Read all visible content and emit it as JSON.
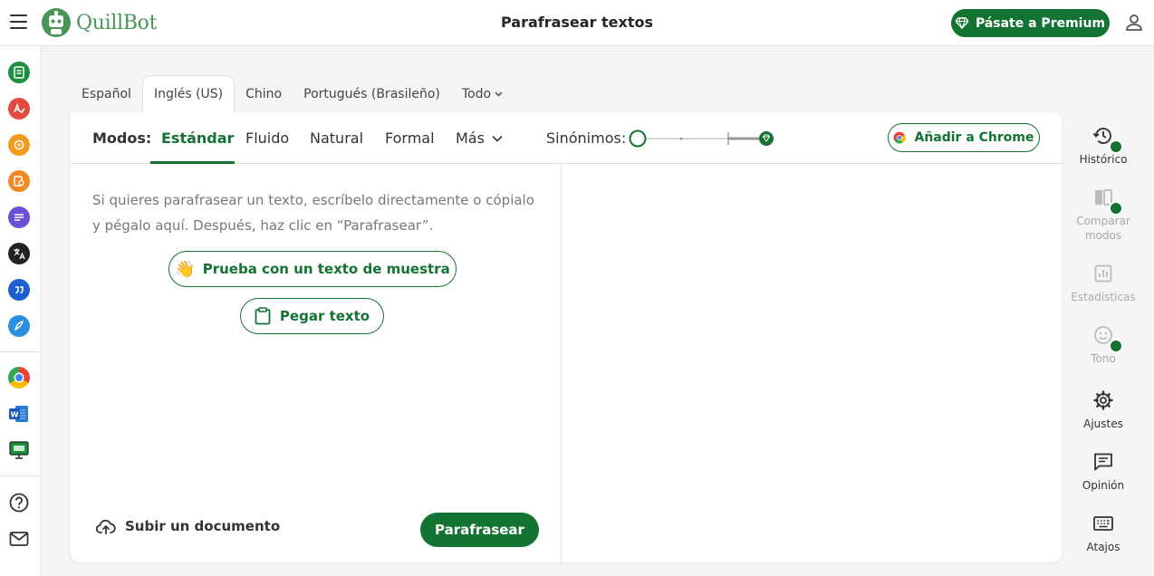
{
  "header": {
    "brand": "QuillBot",
    "title": "Parafrasear textos",
    "premium_label": "Pásate a Premium"
  },
  "left_sidebar": {
    "items": [
      {
        "name": "paraphraser-icon",
        "color": "#1a8f3c"
      },
      {
        "name": "grammar-checker-icon",
        "color": "#e04a3f"
      },
      {
        "name": "ai-detector-icon",
        "color": "#f59b1b"
      },
      {
        "name": "plagiarism-checker-icon",
        "color": "#f08a24"
      },
      {
        "name": "summarizer-icon",
        "color": "#6a4fd8"
      },
      {
        "name": "translator-icon",
        "color": "#222222"
      },
      {
        "name": "citation-generator-icon",
        "color": "#1d5fd0"
      },
      {
        "name": "quillbot-flow-icon",
        "color": "#2b8fe0"
      }
    ],
    "extensions": [
      {
        "name": "chrome-extension-icon"
      },
      {
        "name": "word-extension-icon"
      },
      {
        "name": "desktop-app-icon"
      }
    ],
    "bottom": [
      {
        "name": "help-icon"
      },
      {
        "name": "mail-icon"
      }
    ]
  },
  "languages": {
    "tabs": [
      "Español",
      "Inglés (US)",
      "Chino",
      "Portugués (Brasileño)",
      "Todo"
    ],
    "active": "Inglés (US)"
  },
  "modes": {
    "label": "Modos:",
    "items": [
      "Estándar",
      "Fluido",
      "Natural",
      "Formal",
      "Más"
    ],
    "active": "Estándar",
    "synonyms_label": "Sinónimos:",
    "synonyms_level": 0.0
  },
  "chrome_button": "Añadir a Chrome",
  "editor": {
    "placeholder": "Si quieres parafrasear un texto, escríbelo directamente o cópialo y pégalo aquí. Después, haz clic en “Parafrasear”.",
    "sample_label": "Prueba con un texto de muestra",
    "sample_emoji": "👋",
    "paste_label": "Pegar texto",
    "upload_label": "Subir un documento",
    "paraphrase_label": "Parafrasear"
  },
  "right_sidebar": {
    "items": [
      {
        "label": "Histórico",
        "icon": "history-icon",
        "enabled": true,
        "premium": true
      },
      {
        "label": "Comparar modos",
        "icon": "compare-modes-icon",
        "enabled": false,
        "premium": true
      },
      {
        "label": "Estadísticas",
        "icon": "statistics-icon",
        "enabled": false,
        "premium": false
      },
      {
        "label": "Tono",
        "icon": "tone-icon",
        "enabled": false,
        "premium": true
      },
      {
        "label": "Ajustes",
        "icon": "settings-icon",
        "enabled": true,
        "premium": false
      },
      {
        "label": "Opinión",
        "icon": "feedback-icon",
        "enabled": true,
        "premium": false
      },
      {
        "label": "Atajos",
        "icon": "keyboard-shortcuts-icon",
        "enabled": true,
        "premium": false
      }
    ]
  },
  "colors": {
    "brand_green": "#137333",
    "logo_green": "#499557"
  }
}
